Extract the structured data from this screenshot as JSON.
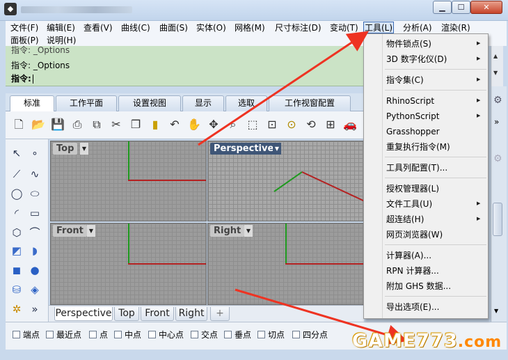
{
  "window": {
    "controls": {
      "minimize": "▁",
      "maximize": "☐",
      "close": "✕"
    }
  },
  "menubar": {
    "items": [
      "文件(F)",
      "编辑(E)",
      "查看(V)",
      "曲线(C)",
      "曲面(S)",
      "实体(O)",
      "网格(M)",
      "尺寸标注(D)",
      "变动(T)",
      "工具(L)",
      "分析(A)",
      "渲染(R)",
      "面板(P)",
      "说明(H)"
    ]
  },
  "command": {
    "history_1": "指令: _Options",
    "history_2": "指令: _Options",
    "prompt": "指令:"
  },
  "tabs": {
    "items": [
      "标准",
      "工作平面",
      "设置视图",
      "显示",
      "选取",
      "工作视窗配置"
    ],
    "active": "标准"
  },
  "viewports": {
    "top": "Top",
    "perspective": "Perspective",
    "front": "Front",
    "right": "Right",
    "active": "Perspective"
  },
  "view_tabs": {
    "items": [
      "Perspective",
      "Top",
      "Front",
      "Right"
    ],
    "add": "+"
  },
  "osnap": {
    "items": [
      "端点",
      "最近点",
      "点",
      "中点",
      "中心点",
      "交点",
      "垂点",
      "切点",
      "四分点"
    ]
  },
  "tools_menu": {
    "groups": [
      [
        {
          "label": "物件锁点(S)",
          "sub": true
        },
        {
          "label": "3D 数字化仪(D)",
          "sub": true
        }
      ],
      [
        {
          "label": "指令集(C)",
          "sub": true
        }
      ],
      [
        {
          "label": "RhinoScript",
          "sub": true
        },
        {
          "label": "PythonScript",
          "sub": true
        },
        {
          "label": "Grasshopper",
          "sub": false
        },
        {
          "label": "重复执行指令(M)",
          "sub": false
        }
      ],
      [
        {
          "label": "工具列配置(T)...",
          "sub": false
        }
      ],
      [
        {
          "label": "授权管理器(L)",
          "sub": false
        },
        {
          "label": "文件工具(U)",
          "sub": true
        },
        {
          "label": "超连结(H)",
          "sub": true
        },
        {
          "label": "网页浏览器(W)",
          "sub": false
        }
      ],
      [
        {
          "label": "计算器(A)...",
          "sub": false
        },
        {
          "label": "RPN 计算器...",
          "sub": false
        },
        {
          "label": "附加 GHS 数据...",
          "sub": false
        }
      ],
      [
        {
          "label": "导出选项(E)...",
          "sub": false
        }
      ]
    ]
  },
  "watermark": {
    "text": "GAME773",
    "suffix": ".com"
  },
  "colors": {
    "command_bg": "#cbe3c6",
    "viewport_bg": "#9c9c9c",
    "axis_x": "#b42222",
    "axis_y": "#1f9a1f",
    "arrow": "#ee3322",
    "active_viewport_label": "#3f5677"
  }
}
